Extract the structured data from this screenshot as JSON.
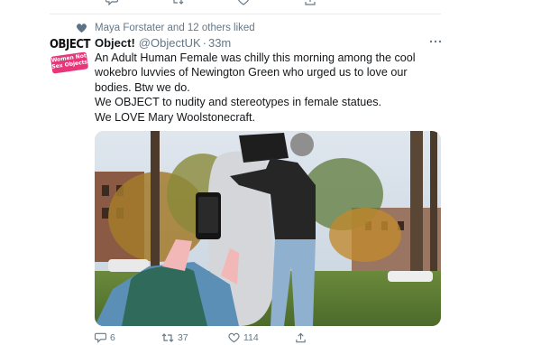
{
  "tweet": {
    "social_context": "Maya Forstater and 12 others liked",
    "author_name": "Object!",
    "author_handle": "@ObjectUK",
    "separator": "·",
    "timestamp": "33m",
    "avatar": {
      "logo_text": "OBJECT",
      "logo_tagline": "Women Not Sex Objects"
    },
    "text": "An Adult Human Female was chilly this morning among the cool wokebro luvvies of Newington Green  who urged us to love our bodies. Btw we do.\nWe OBJECT to nudity and stereotypes in female statues.\nWe LOVE Mary Woolstonecraft.",
    "media_description": "photo",
    "actions": {
      "reply_count": "6",
      "retweet_count": "37",
      "like_count": "114"
    }
  },
  "icons": {
    "reply": "reply-icon",
    "retweet": "retweet-icon",
    "like": "heart-icon",
    "share": "share-icon",
    "more": "more-icon",
    "social_like": "heart-filled-icon"
  },
  "colors": {
    "secondary_text": "#657786",
    "primary_text": "#14171a",
    "social_heart": "#5a7388",
    "brand_pink": "#e8367a",
    "divider": "#e6ecf0"
  }
}
